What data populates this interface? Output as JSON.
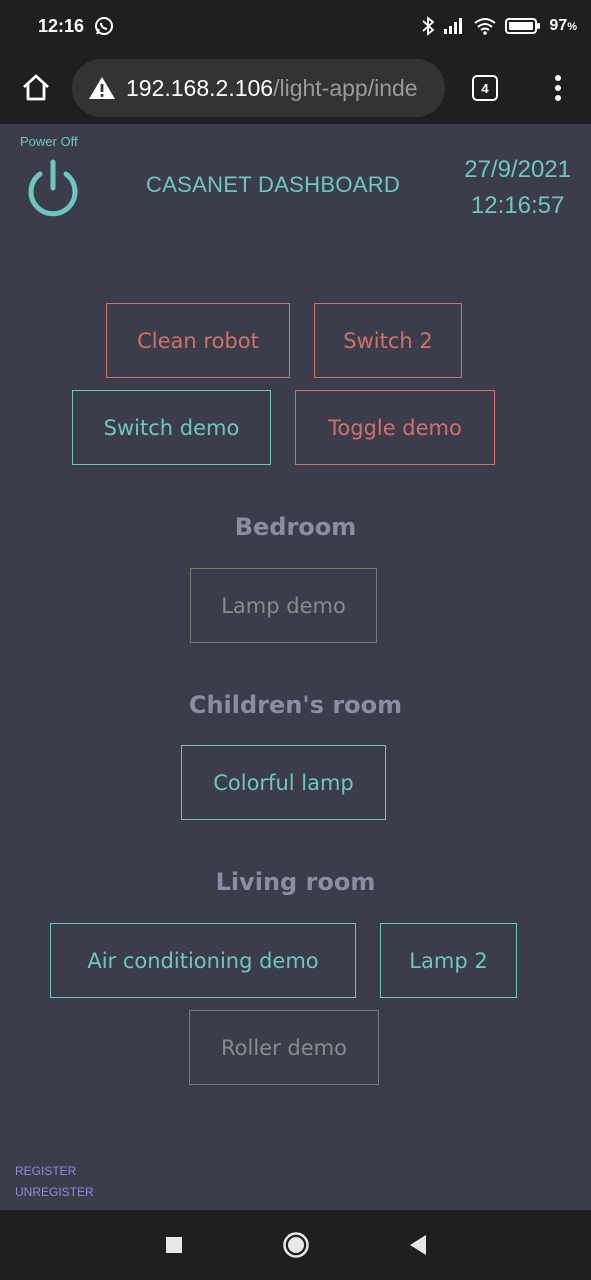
{
  "status_bar": {
    "time": "12:16",
    "battery": "97",
    "battery_unit": "%"
  },
  "browser": {
    "url_host": "192.168.2.106",
    "url_path": "/light-app/inde",
    "tab_count": "4"
  },
  "header": {
    "power_label": "Power Off",
    "title": "CASANET DASHBOARD",
    "date": "27/9/2021",
    "time": "12:16:57"
  },
  "devices": {
    "clean_robot": "Clean robot",
    "switch_2": "Switch 2",
    "switch_demo": "Switch demo",
    "toggle_demo": "Toggle demo"
  },
  "rooms": {
    "bedroom": {
      "title": "Bedroom",
      "lamp_demo": "Lamp demo"
    },
    "childrens_room": {
      "title": "Children's room",
      "colorful_lamp": "Colorful lamp"
    },
    "living_room": {
      "title": "Living room",
      "air_conditioning_demo": "Air conditioning demo",
      "lamp_2": "Lamp 2",
      "roller_demo": "Roller demo"
    }
  },
  "footer": {
    "register": "REGISTER",
    "unregister": "UNREGISTER"
  },
  "colors": {
    "background": "#3c3d4a",
    "accent_on": "#6fc6c0",
    "accent_off": "#d0706b",
    "unavailable": "#7a7a7a",
    "room_title": "#8c8ca3",
    "link": "#8c8cd8"
  }
}
